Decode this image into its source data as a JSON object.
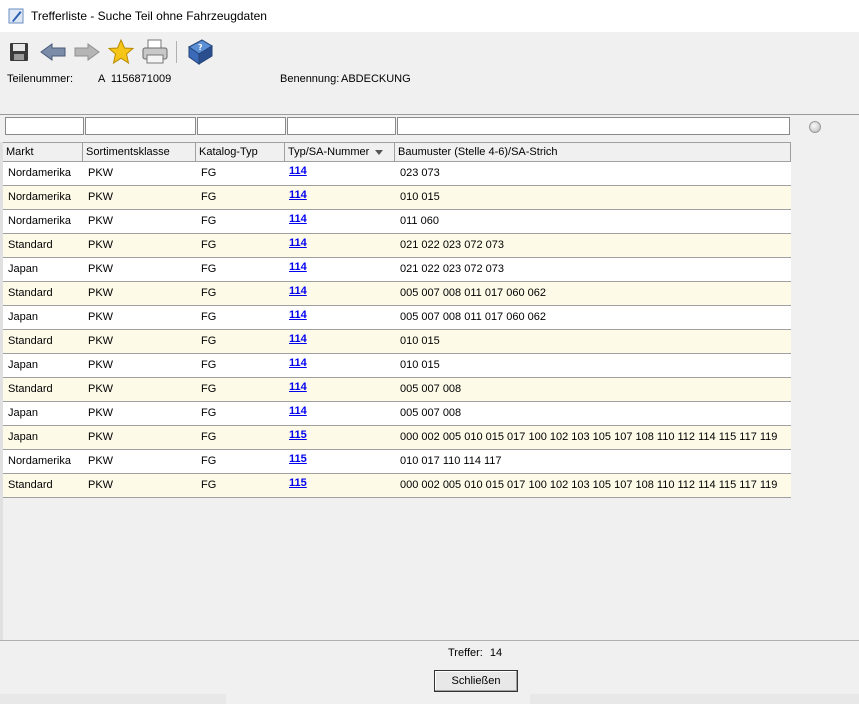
{
  "window": {
    "title": "Trefferliste - Suche Teil ohne Fahrzeugdaten"
  },
  "toolbar": {
    "icons": [
      "save-icon",
      "back-arrow-icon",
      "forward-arrow-icon",
      "favorite-star-icon",
      "print-icon",
      "help-book-icon"
    ]
  },
  "info": {
    "teilenummer_label": "Teilenummer:",
    "teilenummer_value": "A  1156871009",
    "benennung_label": "Benennung:",
    "benennung_value": "ABDECKUNG"
  },
  "filters": [
    "",
    "",
    "",
    "",
    ""
  ],
  "table": {
    "headers": [
      "Markt",
      "Sortimentsklasse",
      "Katalog-Typ",
      "Typ/SA-Nummer",
      "Baumuster (Stelle 4-6)/SA-Strich"
    ],
    "sorted_column": "Typ/SA-Nummer",
    "rows": [
      [
        "Nordamerika",
        "PKW",
        "FG",
        "114",
        "023 073"
      ],
      [
        "Nordamerika",
        "PKW",
        "FG",
        "114",
        "010 015"
      ],
      [
        "Nordamerika",
        "PKW",
        "FG",
        "114",
        "011 060"
      ],
      [
        "Standard",
        "PKW",
        "FG",
        "114",
        "021 022 023 072 073"
      ],
      [
        "Japan",
        "PKW",
        "FG",
        "114",
        "021 022 023 072 073"
      ],
      [
        "Standard",
        "PKW",
        "FG",
        "114",
        "005 007 008 011 017 060 062"
      ],
      [
        "Japan",
        "PKW",
        "FG",
        "114",
        "005 007 008 011 017 060 062"
      ],
      [
        "Standard",
        "PKW",
        "FG",
        "114",
        "010 015"
      ],
      [
        "Japan",
        "PKW",
        "FG",
        "114",
        "010 015"
      ],
      [
        "Standard",
        "PKW",
        "FG",
        "114",
        "005 007 008"
      ],
      [
        "Japan",
        "PKW",
        "FG",
        "114",
        "005 007 008"
      ],
      [
        "Japan",
        "PKW",
        "FG",
        "115",
        "000 002 005 010 015 017 100 102 103 105 107 108 110 112 114 115 117 119"
      ],
      [
        "Nordamerika",
        "PKW",
        "FG",
        "115",
        "010 017 110 114 117"
      ],
      [
        "Standard",
        "PKW",
        "FG",
        "115",
        "000 002 005 010 015 017 100 102 103 105 107 108 110 112 114 115 117 119"
      ]
    ]
  },
  "footer": {
    "hits_label": "Treffer:",
    "hits_value": "14",
    "close_label": "Schließen"
  },
  "colors": {
    "row_alt": "#fdfae8",
    "link": "#0000ee"
  }
}
